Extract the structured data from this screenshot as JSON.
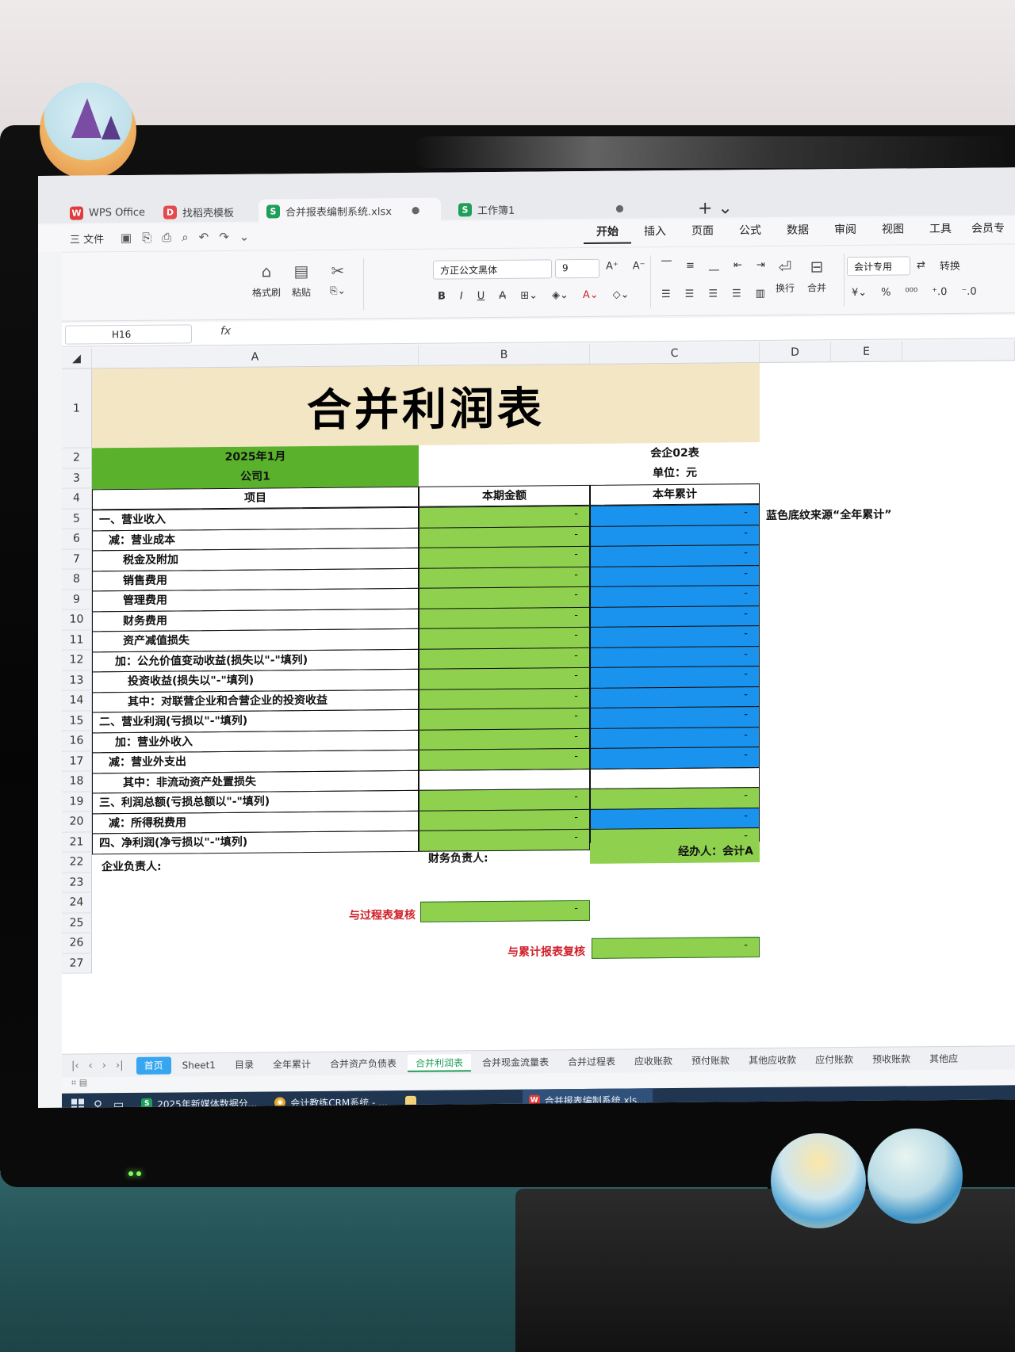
{
  "window_tabs": [
    {
      "label": "WPS Office",
      "icon": "wps-logo-icon"
    },
    {
      "label": "找稻壳模板",
      "icon": "docer-icon"
    },
    {
      "label": "合并报表编制系统.xlsx",
      "icon": "spreadsheet-icon",
      "active": true
    },
    {
      "label": "工作簿1",
      "icon": "spreadsheet-icon"
    }
  ],
  "menu": {
    "file_label": "三 文件",
    "ribbon_tabs": [
      "开始",
      "插入",
      "页面",
      "公式",
      "数据",
      "审阅",
      "视图",
      "工具",
      "会员专"
    ],
    "active_tab": "开始"
  },
  "ribbon": {
    "format_painter": "格式刷",
    "paste": "粘贴",
    "font_name": "方正公文黑体",
    "font_size": "9",
    "wrap": "换行",
    "merge": "合并",
    "number_format": "会计专用",
    "convert": "转换"
  },
  "formula_bar": {
    "cell_ref": "H16",
    "fx": "fx",
    "content": ""
  },
  "columns": [
    "A",
    "B",
    "C",
    "D",
    "E"
  ],
  "rows": [
    "1",
    "2",
    "3",
    "4",
    "5",
    "6",
    "7",
    "8",
    "9",
    "10",
    "11",
    "12",
    "13",
    "14",
    "15",
    "16",
    "17",
    "18",
    "19",
    "20",
    "21",
    "22",
    "23",
    "24",
    "25",
    "26",
    "27"
  ],
  "sheet": {
    "title": "合并利润表",
    "period": "2025年1月",
    "company": "公司1",
    "form_no": "会企02表",
    "unit": "单位：元",
    "header_item": "项目",
    "header_current": "本期金额",
    "header_ytd": "本年累计",
    "note": "蓝色底纹来源“全年累计”",
    "lines": [
      {
        "label": "一、营业收入",
        "b": "-",
        "c": "-"
      },
      {
        "label": "减：营业成本",
        "b": "-",
        "c": "-"
      },
      {
        "label": "税金及附加",
        "b": "-",
        "c": "-"
      },
      {
        "label": "销售费用",
        "b": "-",
        "c": "-"
      },
      {
        "label": "管理费用",
        "b": "-",
        "c": "-"
      },
      {
        "label": "财务费用",
        "b": "-",
        "c": "-"
      },
      {
        "label": "资产减值损失",
        "b": "-",
        "c": "-"
      },
      {
        "label": "加：公允价值变动收益(损失以\"-\"填列)",
        "b": "-",
        "c": "-"
      },
      {
        "label": "投资收益(损失以\"-\"填列)",
        "b": "-",
        "c": "-"
      },
      {
        "label": "其中：对联营企业和合营企业的投资收益",
        "b": "-",
        "c": "-"
      },
      {
        "label": "二、营业利润(亏损以\"-\"填列)",
        "b": "-",
        "c": "-"
      },
      {
        "label": "加：营业外收入",
        "b": "-",
        "c": "-"
      },
      {
        "label": "减：营业外支出",
        "b": "-",
        "c": "-"
      },
      {
        "label": "其中：非流动资产处置损失",
        "b": "",
        "c": ""
      },
      {
        "label": "三、利润总额(亏损总额以\"-\"填列)",
        "b": "-",
        "c": "-"
      },
      {
        "label": "减：所得税费用",
        "b": "-",
        "c": "-"
      },
      {
        "label": "四、净利润(净亏损以\"-\"填列)",
        "b": "-",
        "c": "-"
      }
    ],
    "signer_company": "企业负责人:",
    "signer_finance": "财务负责人:",
    "signer_handler": "经办人：会计A",
    "check_process_label": "与过程表复核",
    "check_process_value": "-",
    "check_cumulative_label": "与累计报表复核",
    "check_cumulative_value": "-"
  },
  "sheet_tabs": [
    "首页",
    "Sheet1",
    "目录",
    "全年累计",
    "合并资产负债表",
    "合并利润表",
    "合并现金流量表",
    "合并过程表",
    "应收账款",
    "预付账款",
    "其他应收款",
    "应付账款",
    "预收账款",
    "其他应"
  ],
  "active_sheet": "合并利润表",
  "taskbar": [
    {
      "label": "2025年新媒体数据分...",
      "icon": "spreadsheet-icon"
    },
    {
      "label": "会计教练CRM系统 - ...",
      "icon": "chrome-icon"
    },
    {
      "label": "",
      "icon": "folder-icon"
    },
    {
      "label": "合并报表编制系统.xls...",
      "icon": "wps-logo-icon"
    }
  ],
  "colors": {
    "title_bg": "#f3e6c4",
    "green_dark": "#5ab12c",
    "green_light": "#8fd14f",
    "blue": "#1a93ef",
    "note_red": "#d0202a"
  }
}
